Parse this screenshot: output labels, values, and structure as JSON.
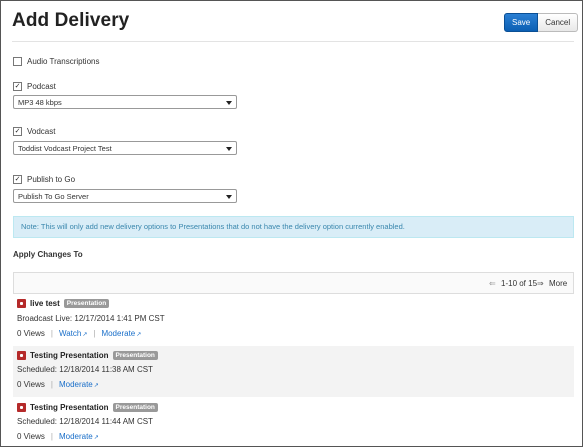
{
  "header": {
    "title": "Add Delivery",
    "save_label": "Save",
    "cancel_label": "Cancel"
  },
  "options": {
    "audio": {
      "label": "Audio Transcriptions",
      "checked": false
    },
    "podcast": {
      "label": "Podcast",
      "checked": true,
      "selected": "MP3 48 kbps"
    },
    "vodcast": {
      "label": "Vodcast",
      "checked": true,
      "selected": "Toddist Vodcast Project Test"
    },
    "publish": {
      "label": "Publish to Go",
      "checked": true,
      "selected": "Publish To Go Server"
    }
  },
  "note": "Note: This will only add new delivery options to Presentations that do not have the delivery option currently enabled.",
  "apply_label": "Apply Changes To",
  "pager": {
    "range": "1-10 of 15",
    "more": "More"
  },
  "items": [
    {
      "title": "live test",
      "badge": "Presentation",
      "status": "Broadcast Live: 12/17/2014 1:41 PM CST",
      "views": "0 Views",
      "watch": "Watch",
      "moderate": "Moderate"
    },
    {
      "title": "Testing Presentation",
      "badge": "Presentation",
      "status": "Scheduled: 12/18/2014 11:38 AM CST",
      "views": "0 Views",
      "moderate": "Moderate"
    },
    {
      "title": "Testing Presentation",
      "badge": "Presentation",
      "status": "Scheduled: 12/18/2014 11:44 AM CST",
      "views": "0 Views",
      "moderate": "Moderate"
    }
  ],
  "colors": {
    "primary": "#0b5fb3",
    "note_bg": "#d9edf7",
    "note_text": "#3a87ad",
    "link": "#1a6fc9",
    "pres_icon": "#b52a2a"
  }
}
